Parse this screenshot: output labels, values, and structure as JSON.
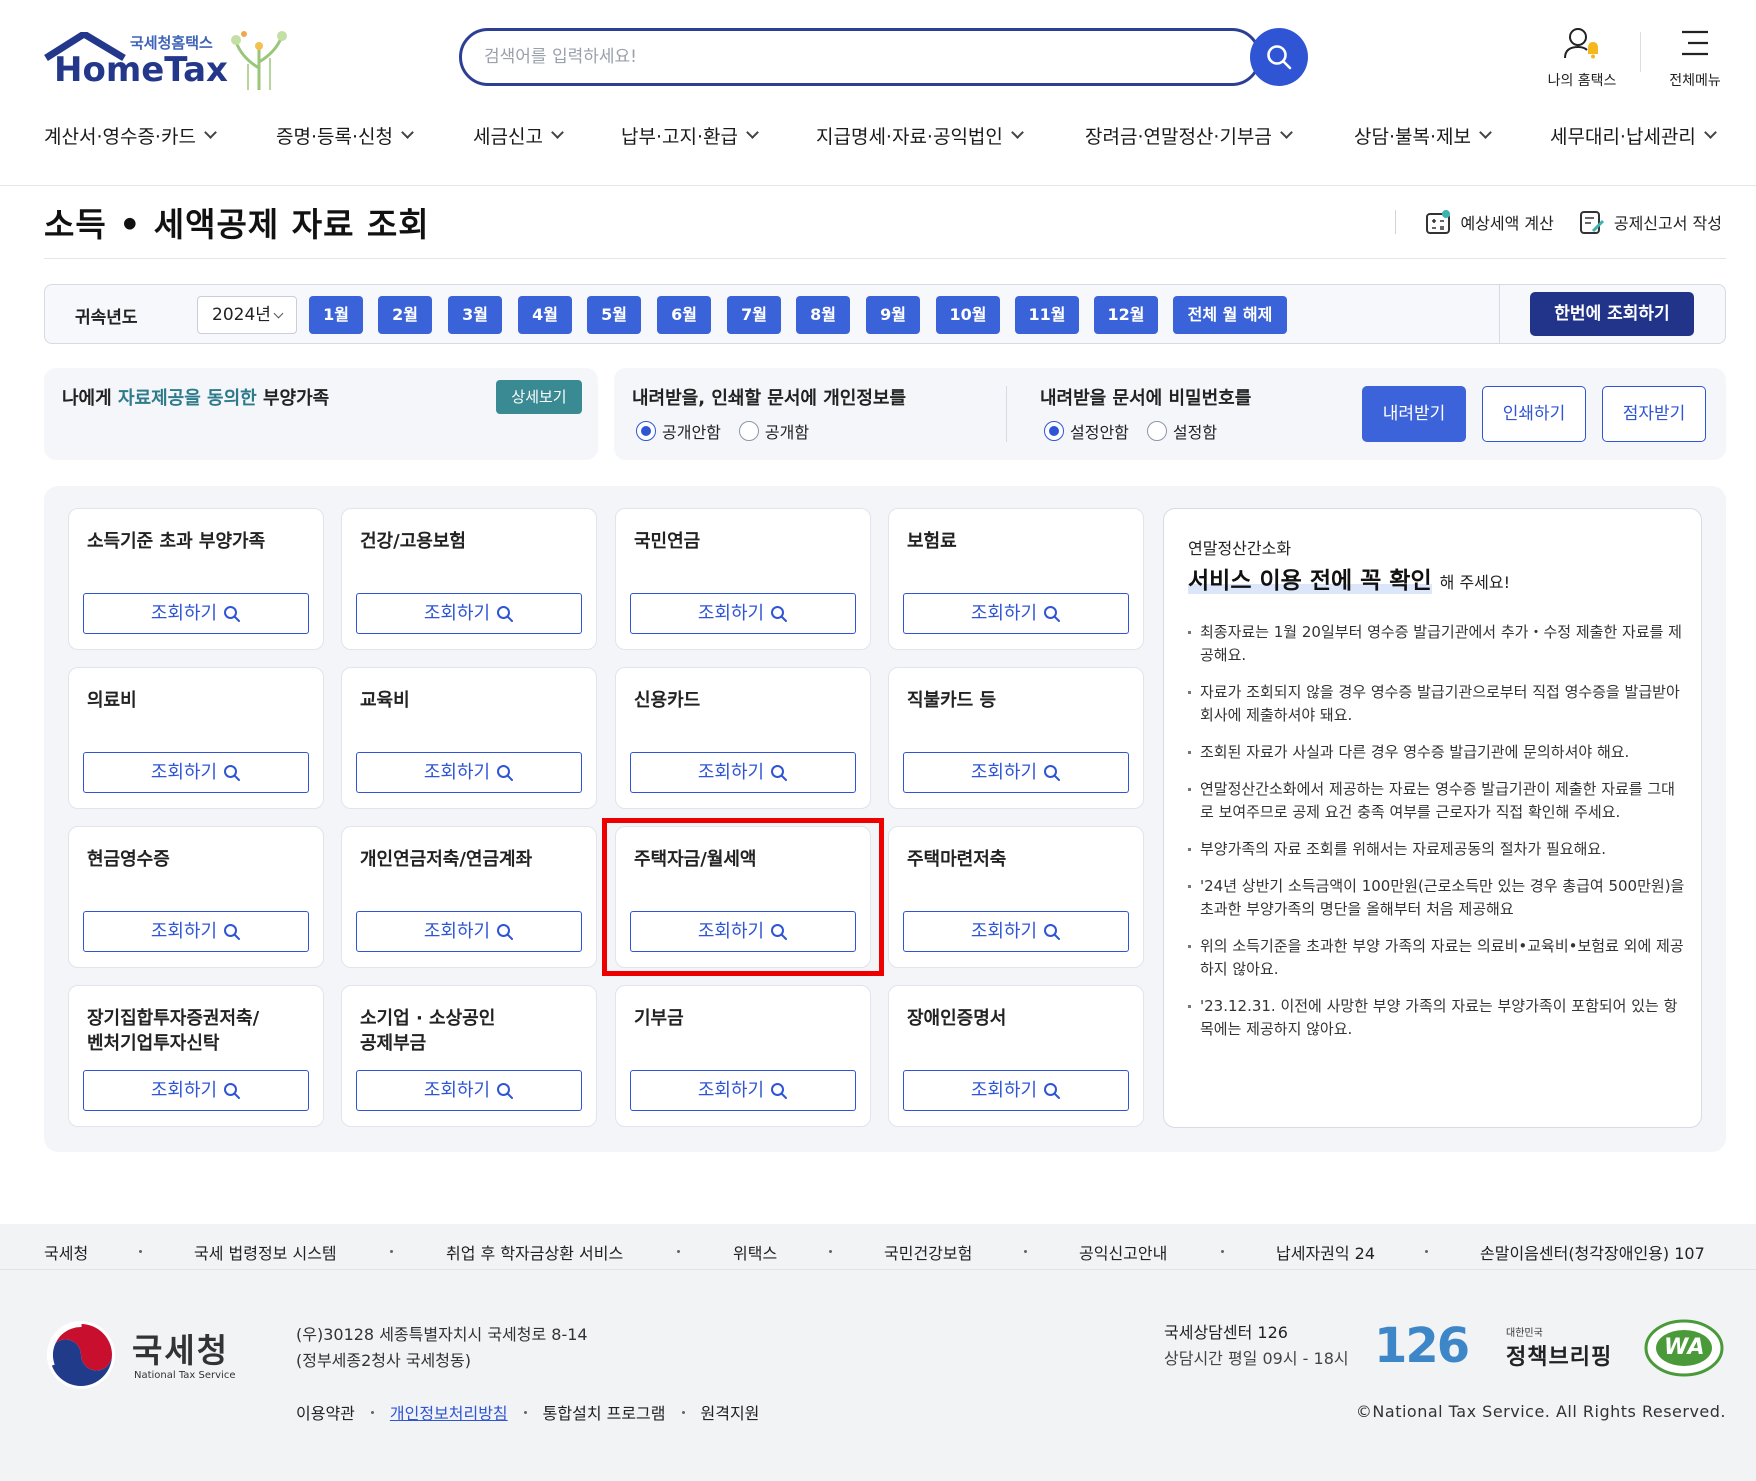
{
  "header": {
    "logo_sub": "국세청홈택스",
    "logo_main": "HomeTax",
    "search_placeholder": "검색어를 입력하세요!",
    "my_hometax": "나의 홈택스",
    "all_menu": "전체메뉴"
  },
  "gnb": [
    {
      "label": "계산서·영수증·카드"
    },
    {
      "label": "증명·등록·신청"
    },
    {
      "label": "세금신고"
    },
    {
      "label": "납부·고지·환급"
    },
    {
      "label": "지급명세·자료·공익법인"
    },
    {
      "label": "장려금·연말정산·기부금"
    },
    {
      "label": "상담·불복·제보"
    },
    {
      "label": "세무대리·납세관리"
    }
  ],
  "page": {
    "title": "소득 • 세액공제 자료 조회",
    "tool_estimate": "예상세액 계산",
    "tool_deduction": "공제신고서 작성"
  },
  "year_bar": {
    "label": "귀속년도",
    "selected_year": "2024년",
    "months": [
      "1월",
      "2월",
      "3월",
      "4월",
      "5월",
      "6월",
      "7월",
      "8월",
      "9월",
      "10월",
      "11월",
      "12월"
    ],
    "clear_all": "전체 월 해제",
    "query_all": "한번에 조회하기"
  },
  "dependents": {
    "prefix": "나에게 ",
    "highlight": "자료제공을 동의한",
    "suffix": " 부양가족",
    "detail_button": "상세보기"
  },
  "options": {
    "privacy_title": "내려받을, 인쇄할 문서에 개인정보를",
    "privacy_options": [
      "공개안함",
      "공개함"
    ],
    "privacy_selected": "공개안함",
    "password_title": "내려받을 문서에 비밀번호를",
    "password_options": [
      "설정안함",
      "설정함"
    ],
    "password_selected": "설정안함",
    "download": "내려받기",
    "print": "인쇄하기",
    "braille": "점자받기"
  },
  "cards": [
    {
      "title": "소득기준 초과 부양가족",
      "button": "조회하기"
    },
    {
      "title": "건강/고용보험",
      "button": "조회하기"
    },
    {
      "title": "국민연금",
      "button": "조회하기"
    },
    {
      "title": "보험료",
      "button": "조회하기"
    },
    {
      "title": "의료비",
      "button": "조회하기"
    },
    {
      "title": "교육비",
      "button": "조회하기"
    },
    {
      "title": "신용카드",
      "button": "조회하기"
    },
    {
      "title": "직불카드 등",
      "button": "조회하기"
    },
    {
      "title": "현금영수증",
      "button": "조회하기"
    },
    {
      "title": "개인연금저축/연금계좌",
      "button": "조회하기"
    },
    {
      "title": "주택자금/월세액",
      "button": "조회하기"
    },
    {
      "title": "주택마련저축",
      "button": "조회하기"
    },
    {
      "title": "장기집합투자증권저축/\n벤처기업투자신탁",
      "button": "조회하기"
    },
    {
      "title": "소기업 · 소상공인\n공제부금",
      "button": "조회하기"
    },
    {
      "title": "기부금",
      "button": "조회하기"
    },
    {
      "title": "장애인증명서",
      "button": "조회하기"
    }
  ],
  "info": {
    "sub": "연말정산간소화",
    "title": "서비스 이용 전에 꼭 확인",
    "title_suffix": "해 주세요!",
    "items": [
      "최종자료는 1월 20일부터 영수증 발급기관에서 추가・수정 제출한 자료를 제공해요.",
      "자료가 조회되지 않을 경우 영수증 발급기관으로부터 직접 영수증을 발급받아 회사에 제출하셔야 돼요.",
      "조회된 자료가 사실과 다른 경우 영수증 발급기관에 문의하셔야 해요.",
      "연말정산간소화에서 제공하는 자료는 영수증 발급기관이 제출한 자료를 그대로 보여주므로 공제 요건 충족 여부를 근로자가 직접 확인해 주세요.",
      "부양가족의 자료 조회를 위해서는 자료제공동의 절차가 필요해요.",
      "'24년 상반기 소득금액이 100만원(근로소득만 있는 경우 총급여 500만원)을 초과한 부양가족의 명단을 올해부터 처음 제공해요",
      "위의 소득기준을 초과한 부양 가족의 자료는 의료비•교육비•보험료 외에 제공하지 않아요.",
      "'23.12.31. 이전에 사망한 부양 가족의 자료는 부양가족이 포함되어 있는 항목에는 제공하지 않아요."
    ]
  },
  "footer": {
    "links": [
      "국세청",
      "국세 법령정보 시스템",
      "취업 후 학자금상환 서비스",
      "위택스",
      "국민건강보험",
      "공익신고안내",
      "납세자권익 24",
      "손말이음센터(청각장애인용) 107"
    ],
    "org_kor": "국세청",
    "org_eng": "National Tax Service",
    "address_line1": "(우)30128 세종특별자치시 국세청로 8-14",
    "address_line2": "(정부세종2청사 국세청동)",
    "nav": [
      "이용약관",
      "개인정보처리방침",
      "통합설치 프로그램",
      "원격지원"
    ],
    "center": "국세상담센터 126",
    "hours": "상담시간 평일 09시 - 18시",
    "badge_126": "126",
    "policy_top": "대한민국",
    "policy_main": "정책브리핑",
    "wa": "WA",
    "copyright": "©National Tax Service. All Rights Reserved."
  },
  "colors": {
    "primary": "#3b63d9",
    "navy": "#22338a",
    "teal": "#3a8a93",
    "highlight_red": "#ee0000"
  }
}
